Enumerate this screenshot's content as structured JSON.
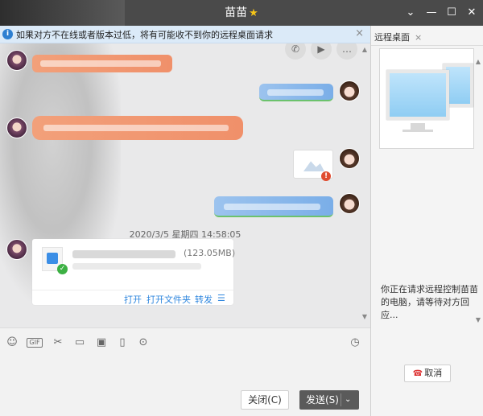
{
  "window": {
    "title": "苗苗",
    "controls": [
      "chevron-down",
      "minimize",
      "maximize",
      "close"
    ]
  },
  "notice": {
    "text": "如果对方不在线或者版本过低，将有可能收不到你的远程桌面请求",
    "info_icon": "i",
    "close_icon": "×"
  },
  "chat": {
    "timestamp": "2020/3/5 星期四 14:58:05",
    "file": {
      "size": "(123.05MB)",
      "actions": [
        "打开",
        "打开文件夹",
        "转发"
      ]
    },
    "colors": {
      "incoming_bubble": "#f0906a",
      "outgoing_bubble": "#7aaee8",
      "link": "#2e86de"
    }
  },
  "toolbar": {
    "tools": [
      "emoji-icon",
      "gif-icon",
      "scissors-icon",
      "folder-icon",
      "image-icon",
      "screen-record-icon",
      "more-icon",
      "history-icon"
    ],
    "gif_label": "GIF"
  },
  "buttons": {
    "close_label": "关闭(C)",
    "send_label": "发送(S)"
  },
  "remote_panel": {
    "tab_label": "远程桌面",
    "tab_close": "×",
    "message": "你正在请求远程控制苗苗的电脑，请等待对方回应...",
    "cancel_label": "取消"
  }
}
